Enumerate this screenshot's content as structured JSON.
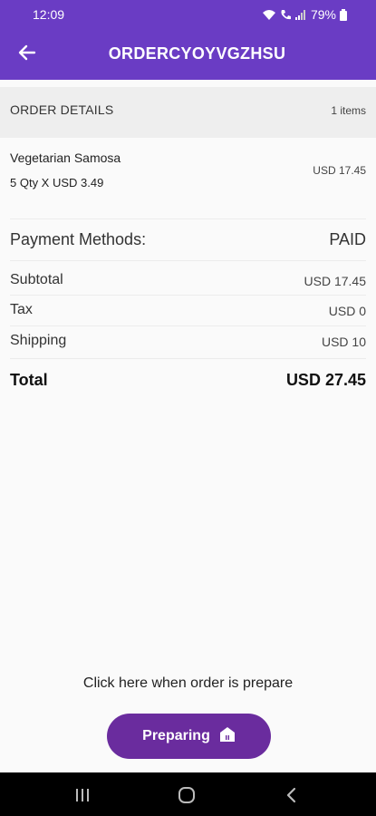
{
  "status_bar": {
    "time": "12:09",
    "battery": "79%",
    "icons": [
      "wifi-icon",
      "call-icon",
      "signal-icon",
      "battery-icon"
    ]
  },
  "app_bar": {
    "title": "ORDERCYOYVGZHSU",
    "back_icon": "back-arrow-icon",
    "color": "#6a3cc4"
  },
  "order_details": {
    "header": "ORDER DETAILS",
    "count": "1 items",
    "items": [
      {
        "name": "Vegetarian Samosa",
        "qty_line": "5 Qty X USD 3.49",
        "price": "USD 17.45"
      }
    ]
  },
  "payment": {
    "label": "Payment Methods:",
    "status": "PAID"
  },
  "summary": {
    "subtotal_label": "Subtotal",
    "subtotal_value": "USD 17.45",
    "tax_label": "Tax",
    "tax_value": "USD 0",
    "shipping_label": "Shipping",
    "shipping_value": "USD 10",
    "total_label": "Total",
    "total_value": "USD 27.45"
  },
  "action": {
    "hint": "Click here when order is prepare",
    "button_label": "Preparing",
    "button_icon": "store-icon",
    "button_color": "#6a2c9e"
  },
  "nav_bar": {
    "icons": [
      "recent-apps-icon",
      "home-icon",
      "back-icon"
    ]
  }
}
